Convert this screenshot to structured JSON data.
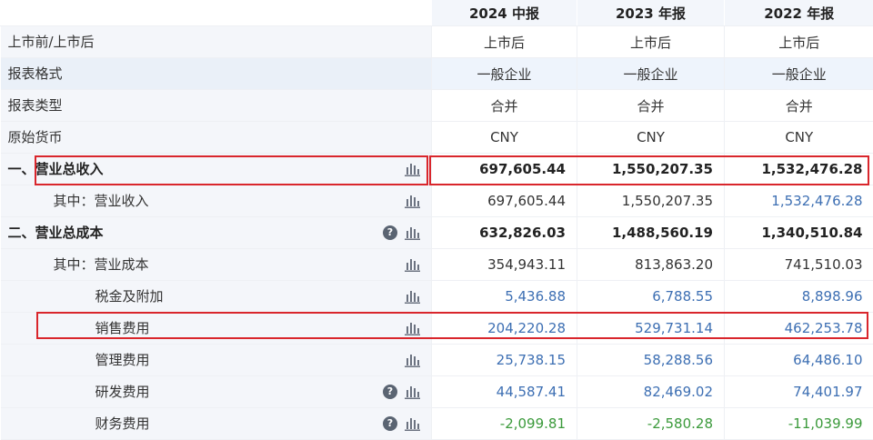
{
  "header": {
    "columns": [
      "2024 中报",
      "2023 年报",
      "2022 年报"
    ]
  },
  "meta_rows": [
    {
      "label": "上市前/上市后",
      "values": [
        "上市后",
        "上市后",
        "上市后"
      ]
    },
    {
      "label": "报表格式",
      "values": [
        "一般企业",
        "一般企业",
        "一般企业"
      ]
    },
    {
      "label": "报表类型",
      "values": [
        "合并",
        "合并",
        "合并"
      ]
    },
    {
      "label": "原始货币",
      "values": [
        "CNY",
        "CNY",
        "CNY"
      ]
    }
  ],
  "data_rows": [
    {
      "label": "一、营业总收入",
      "values": [
        "697,605.44",
        "1,550,207.35",
        "1,532,476.28"
      ],
      "icons": [
        "bar-chart-icon"
      ]
    },
    {
      "label": "其中：营业收入",
      "values": [
        "697,605.44",
        "1,550,207.35",
        "1,532,476.28"
      ],
      "icons": [
        "bar-chart-icon"
      ]
    },
    {
      "label": "二、营业总成本",
      "values": [
        "632,826.03",
        "1,488,560.19",
        "1,340,510.84"
      ],
      "icons": [
        "help-icon",
        "bar-chart-icon"
      ]
    },
    {
      "label": "其中：营业成本",
      "values": [
        "354,943.11",
        "813,863.20",
        "741,510.03"
      ],
      "icons": [
        "bar-chart-icon"
      ]
    },
    {
      "label": "税金及附加",
      "values": [
        "5,436.88",
        "6,788.55",
        "8,898.96"
      ],
      "icons": [
        "bar-chart-icon"
      ]
    },
    {
      "label": "销售费用",
      "values": [
        "204,220.28",
        "529,731.14",
        "462,253.78"
      ],
      "icons": [
        "bar-chart-icon"
      ]
    },
    {
      "label": "管理费用",
      "values": [
        "25,738.15",
        "58,288.56",
        "64,486.10"
      ],
      "icons": [
        "bar-chart-icon"
      ]
    },
    {
      "label": "研发费用",
      "values": [
        "44,587.41",
        "82,469.02",
        "74,401.97"
      ],
      "icons": [
        "help-icon",
        "bar-chart-icon"
      ]
    },
    {
      "label": "财务费用",
      "values": [
        "-2,099.81",
        "-2,580.28",
        "-11,039.99"
      ],
      "icons": [
        "help-icon",
        "bar-chart-icon"
      ]
    }
  ],
  "icons": {
    "help_glyph": "?"
  },
  "colors": {
    "highlight": "#d9262c",
    "link_blue": "#3d6fb3",
    "negative_green": "#3b9a3b"
  }
}
